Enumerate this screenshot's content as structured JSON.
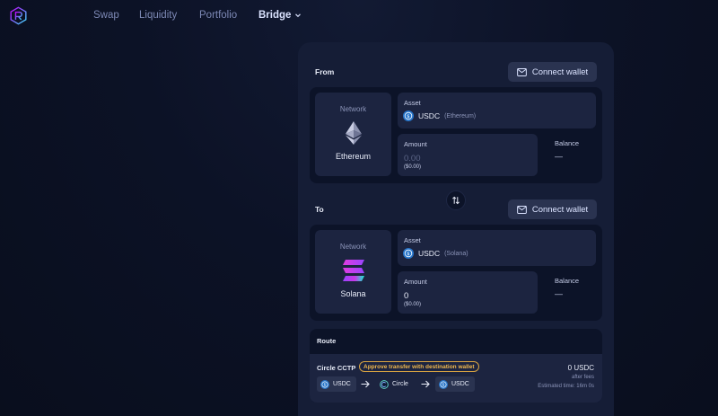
{
  "nav": {
    "items": [
      {
        "label": "Swap"
      },
      {
        "label": "Liquidity"
      },
      {
        "label": "Portfolio"
      },
      {
        "label": "Bridge",
        "active": true
      }
    ]
  },
  "from": {
    "title": "From",
    "connect_label": "Connect wallet",
    "network_label": "Network",
    "network_name": "Ethereum",
    "asset_label": "Asset",
    "asset_symbol": "USDC",
    "asset_chain": "(Ethereum)",
    "amount_label": "Amount",
    "amount_placeholder": "0.00",
    "amount_usd": "($0.00)",
    "balance_label": "Balance",
    "balance_value": "—"
  },
  "to": {
    "title": "To",
    "connect_label": "Connect wallet",
    "network_label": "Network",
    "network_name": "Solana",
    "asset_label": "Asset",
    "asset_symbol": "USDC",
    "asset_chain": "(Solana)",
    "amount_label": "Amount",
    "amount_value": "0",
    "amount_usd": "($0.00)",
    "balance_label": "Balance",
    "balance_value": "—"
  },
  "route": {
    "title": "Route",
    "name": "Circle CCTP",
    "badge": "Approve transfer with destination wallet",
    "hops": [
      "USDC",
      "Circle",
      "USDC"
    ],
    "output": "0 USDC",
    "fees_note": "after fees",
    "estimated_time": "Estimated time: 16m 0s"
  },
  "colors": {
    "background": "#0c1226",
    "card": "#151d36",
    "panel": "#0c1328",
    "field": "#1c2440",
    "button": "#2a3350",
    "badge": "#f0b84e",
    "usdc_blue": "#2775ca"
  },
  "icons": {
    "logo": "raydium-logo",
    "wallet": "wallet-icon",
    "swap": "swap-direction-icon",
    "ethereum": "ethereum-logo",
    "solana": "solana-logo",
    "usdc": "usdc-icon",
    "circle": "circle-icon",
    "arrow": "arrow-right-icon"
  }
}
